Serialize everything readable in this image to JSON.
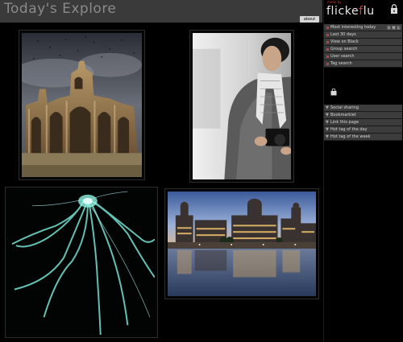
{
  "header": {
    "title": "Today's Explore",
    "about_label": "about"
  },
  "sidebar": {
    "brand_prefix": "made by",
    "brand_main": "flicke",
    "brand_accent": "f",
    "brand_suffix": "lu",
    "nav_items": [
      {
        "label": "Most interesting today"
      },
      {
        "label": "Last 30 days"
      },
      {
        "label": "View on Black"
      },
      {
        "label": "Group search"
      },
      {
        "label": "User search"
      },
      {
        "label": "Tag search"
      }
    ],
    "size_tags": [
      "S",
      "M",
      "L"
    ],
    "share_items": [
      {
        "label": "Social sharing"
      },
      {
        "label": "Bookmarklet"
      },
      {
        "label": "Link this page"
      },
      {
        "label": "Hot tag of the day"
      },
      {
        "label": "Hot tag of the week"
      }
    ]
  },
  "gallery": {
    "photos": [
      {
        "name": "ruined-church-photo",
        "subject": "ruined-church"
      },
      {
        "name": "photographer-photo",
        "subject": "photographer"
      },
      {
        "name": "jellyfish-photo",
        "subject": "jellyfish"
      },
      {
        "name": "waterfront-photo",
        "subject": "waterfront"
      }
    ]
  },
  "colors": {
    "header_bg": "#3a3a3a",
    "menu_bg": "#3c3c3c",
    "accent_red": "#d63b3b"
  }
}
